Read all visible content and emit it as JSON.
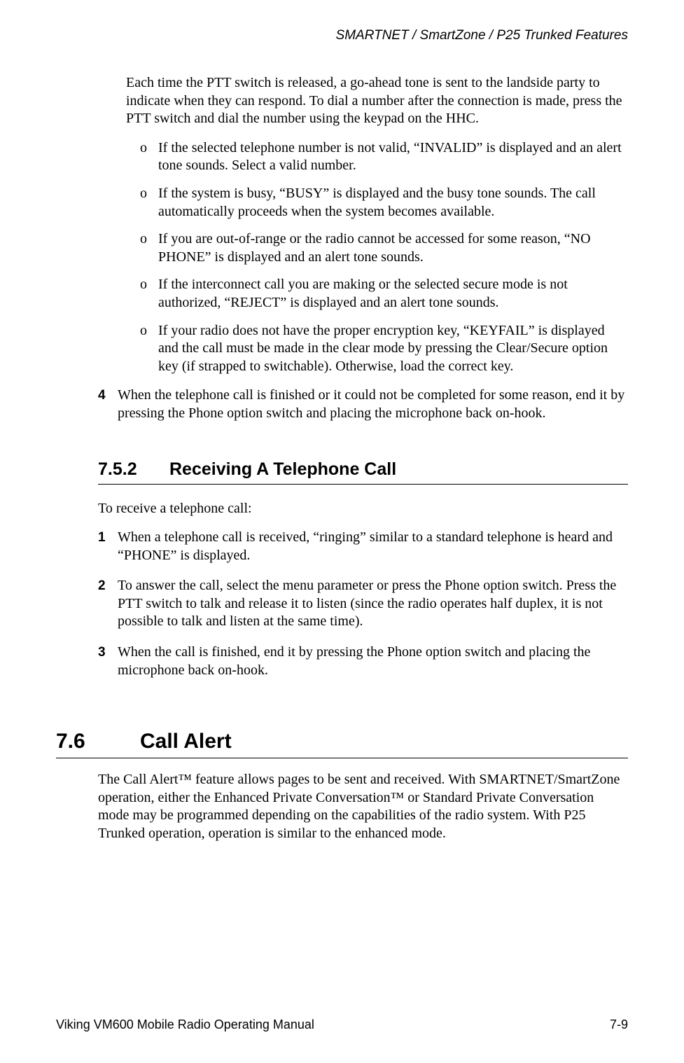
{
  "header": {
    "running_title": "SMARTNET / SmartZone / P25 Trunked Features"
  },
  "intro_para": "Each time the PTT switch is released, a go-ahead tone is sent to the landside party to indicate when they can respond. To dial a number after the connection is made, press the PTT switch and dial the number using the keypad on the HHC.",
  "sub_items": [
    "If the selected telephone number is not valid, “INVALID” is displayed and an alert tone sounds. Select a valid number.",
    "If the system is busy, “BUSY” is displayed and the busy tone sounds. The call automatically proceeds when the system becomes available.",
    "If you are out-of-range or the radio cannot be accessed for some reason, “NO PHONE” is displayed and an alert tone sounds.",
    "If the interconnect call you are making or the selected secure mode is not authorized, “REJECT” is displayed and an alert tone sounds.",
    "If your radio does not have the proper encryption key, “KEYFAIL” is displayed and the call must be made in the clear mode by pressing the Clear/Secure option key (if strapped to switchable). Otherwise, load the correct key."
  ],
  "sub_marker": "o",
  "step4": {
    "marker": "4",
    "text": "When the telephone call is finished or it could not be completed for some reason, end it by pressing the Phone option switch and placing the microphone back on-hook."
  },
  "section_752": {
    "number": "7.5.2",
    "title": "Receiving A Telephone Call",
    "intro": "To receive a telephone call:",
    "steps": [
      {
        "marker": "1",
        "text": "When a telephone call is received, “ringing” similar to a standard telephone is heard and “PHONE” is displayed."
      },
      {
        "marker": "2",
        "text": "To answer the call, select the menu parameter or press the Phone option switch. Press the PTT switch to talk and release it to listen (since the radio operates half duplex, it is not possible to talk and listen at the same time)."
      },
      {
        "marker": "3",
        "text": "When the call is finished, end it by pressing the Phone option switch and placing the microphone back on-hook."
      }
    ]
  },
  "section_76": {
    "number": "7.6",
    "title": "Call Alert",
    "body": "The Call Alert™ feature allows pages to be sent and received. With SMARTNET/SmartZone operation, either the Enhanced Private Conversation™ or Standard Private Conversation mode may be programmed depending on the capabilities of the radio system. With P25 Trunked operation, operation is similar to the enhanced mode."
  },
  "footer": {
    "left": "Viking VM600 Mobile Radio Operating Manual",
    "right": "7-9"
  }
}
